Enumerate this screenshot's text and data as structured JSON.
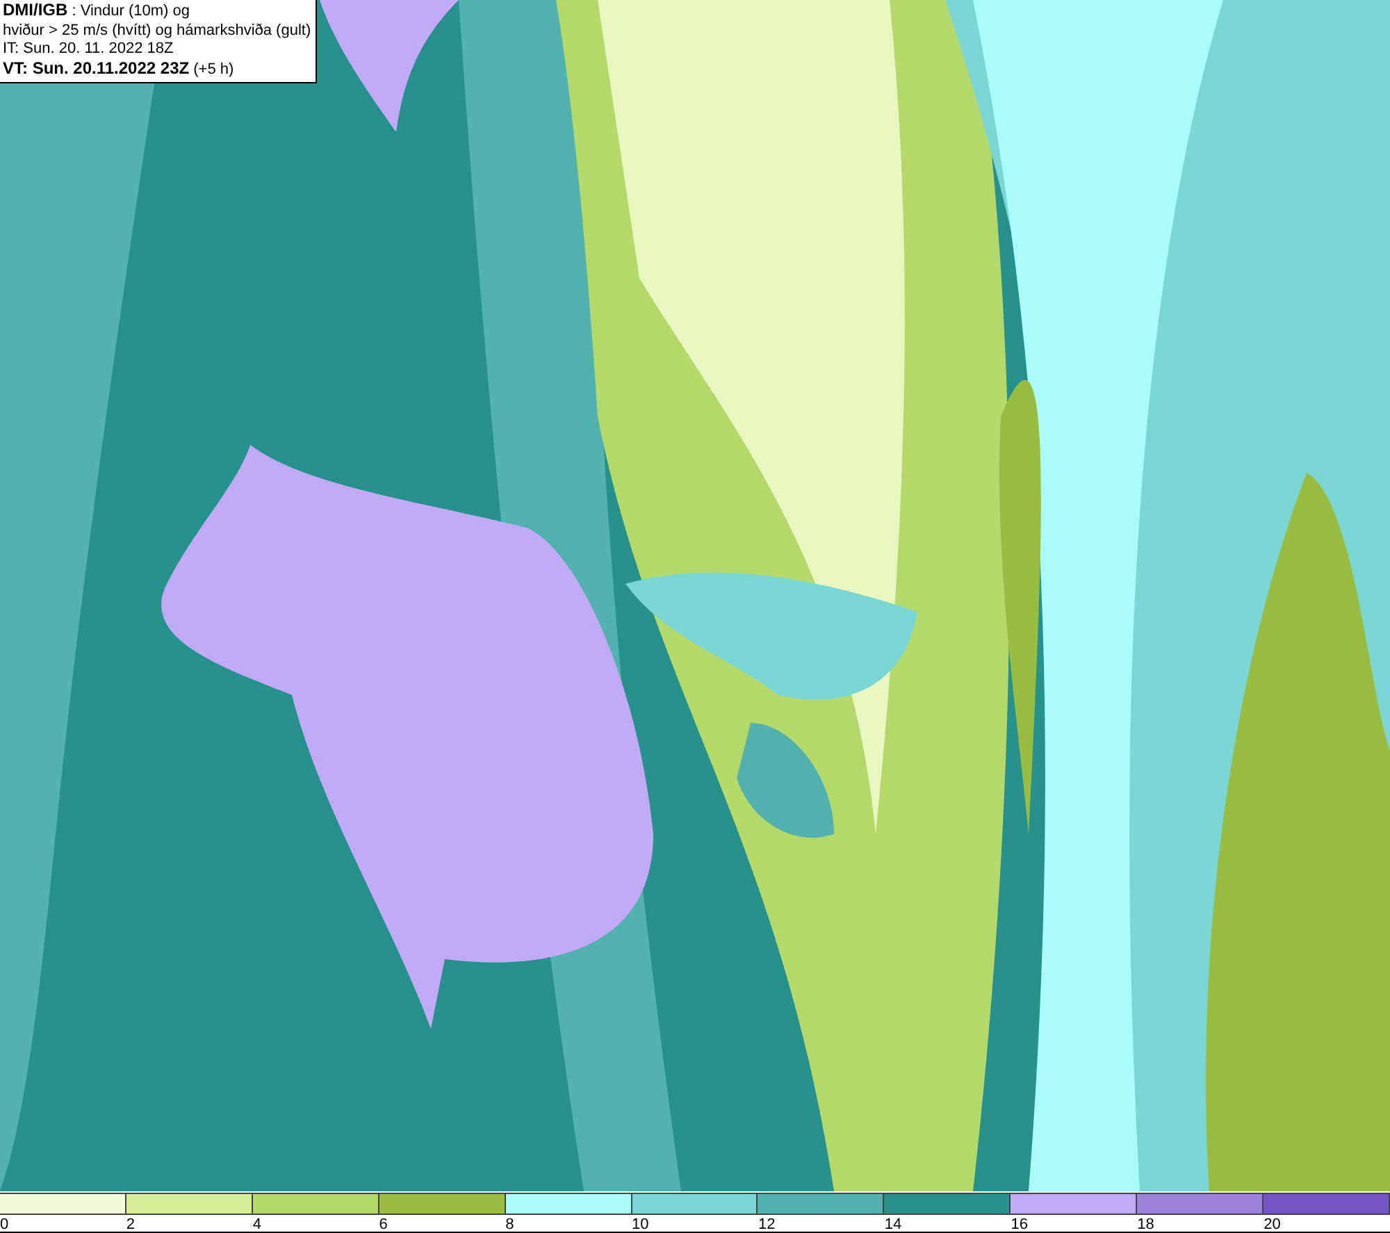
{
  "info_box": {
    "lines": [
      "**DMI/IGB** : Vindur (10m) og",
      "hviður > 25 m/s (hvítt) og hámarkshviða (gult)",
      "IT: Sun. 20. 11. 2022 18Z",
      "**VT: Sun. 20.11.2022 23Z** (+5 h)"
    ]
  },
  "legend": [
    {
      "label": "0",
      "color": "#f2fbdc"
    },
    {
      "label": "2",
      "color": "#d5ef98"
    },
    {
      "label": "4",
      "color": "#b5d86a"
    },
    {
      "label": "6",
      "color": "#98bd40"
    },
    {
      "label": "8",
      "color": "#aafcf8"
    },
    {
      "label": "10",
      "color": "#7ad6d3"
    },
    {
      "label": "12",
      "color": "#52b2b0"
    },
    {
      "label": "14",
      "color": "#27918d"
    },
    {
      "label": "16",
      "color": "#c2a9f5"
    },
    {
      "label": "18",
      "color": "#9d80dc"
    },
    {
      "label": "20",
      "color": "#7453c4"
    }
  ]
}
